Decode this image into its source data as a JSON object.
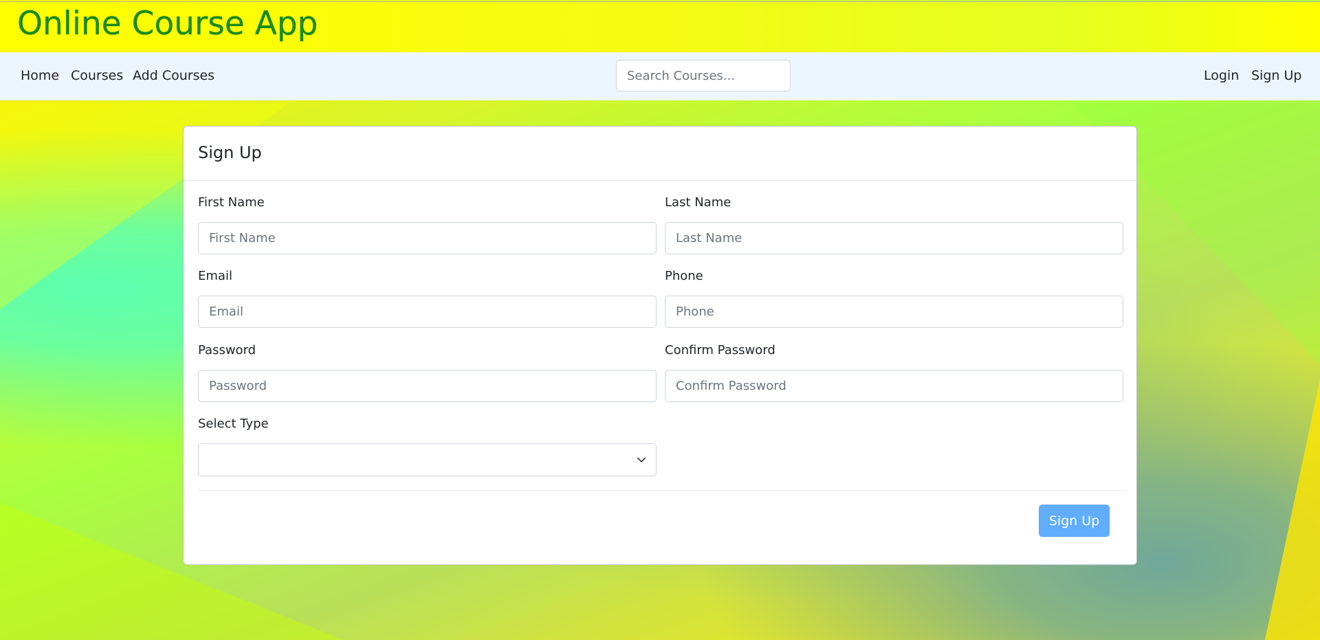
{
  "app": {
    "title": "Online Course App"
  },
  "nav": {
    "home": "Home",
    "courses": "Courses",
    "add_courses": "Add Courses",
    "login": "Login",
    "sign_up": "Sign Up",
    "search_placeholder": "Search Courses..."
  },
  "form": {
    "title": "Sign Up",
    "first_name": {
      "label": "First Name",
      "placeholder": "First Name",
      "value": ""
    },
    "last_name": {
      "label": "Last Name",
      "placeholder": "Last Name",
      "value": ""
    },
    "email": {
      "label": "Email",
      "placeholder": "Email",
      "value": ""
    },
    "phone": {
      "label": "Phone",
      "placeholder": "Phone",
      "value": ""
    },
    "password": {
      "label": "Password",
      "placeholder": "Password",
      "value": ""
    },
    "confirm_password": {
      "label": "Confirm Password",
      "placeholder": "Confirm Password",
      "value": ""
    },
    "select_type": {
      "label": "Select Type",
      "selected": ""
    },
    "submit_label": "Sign Up"
  },
  "colors": {
    "title_green": "#1a8a1a",
    "header_yellow": "#ffff00",
    "navbar_bg": "#eef6fd",
    "button_blue": "#60adfb"
  },
  "icons": {
    "select_chevron": "chevron-down-icon"
  }
}
